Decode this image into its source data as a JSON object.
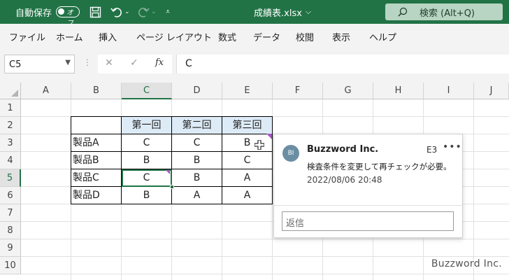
{
  "titlebar": {
    "autosave_label": "自動保存",
    "autosave_state": "オフ",
    "filename": "成績表.xlsx",
    "search_label": "検索 (Alt+Q)"
  },
  "menu": [
    "ファイル",
    "ホーム",
    "挿入",
    "ページ レイアウト",
    "数式",
    "データ",
    "校閲",
    "表示",
    "ヘルプ"
  ],
  "formula_bar": {
    "name_box": "C5",
    "fx_label": "fx",
    "content": "C"
  },
  "columns": [
    "A",
    "B",
    "C",
    "D",
    "E",
    "F",
    "G",
    "H",
    "I",
    "J"
  ],
  "rows": [
    "1",
    "2",
    "3",
    "4",
    "5",
    "6",
    "7",
    "8",
    "9",
    "10"
  ],
  "active_cell": {
    "column": "C",
    "row": "5"
  },
  "table": {
    "headers": [
      "第一回",
      "第二回",
      "第三回"
    ],
    "rows": [
      {
        "label": "製品A",
        "values": [
          "C",
          "C",
          "B"
        ]
      },
      {
        "label": "製品B",
        "values": [
          "B",
          "B",
          "C"
        ]
      },
      {
        "label": "製品C",
        "values": [
          "C",
          "B",
          "A"
        ]
      },
      {
        "label": "製品D",
        "values": [
          "B",
          "A",
          "A"
        ]
      }
    ]
  },
  "comment": {
    "avatar_initials": "BI",
    "author": "Buzzword Inc.",
    "cell_ref": "E3",
    "text": "検査条件を変更して再チェックが必要。",
    "timestamp": "2022/08/06 20:48",
    "reply_placeholder": "返信"
  },
  "watermark": "Buzzword Inc.",
  "colors": {
    "excel_green": "#217346",
    "header_fill": "#ddebf7",
    "comment_marker": "#a855c8"
  }
}
